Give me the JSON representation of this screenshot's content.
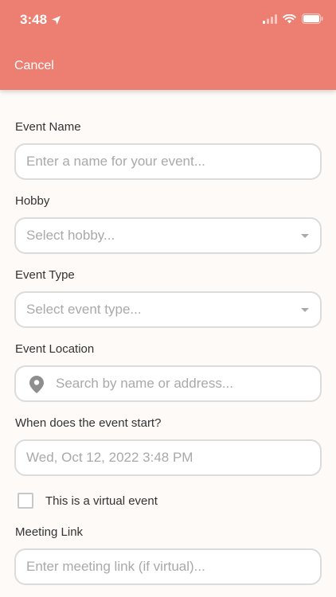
{
  "status_bar": {
    "time": "3:48"
  },
  "header": {
    "cancel_label": "Cancel"
  },
  "form": {
    "event_name": {
      "label": "Event Name",
      "placeholder": "Enter a name for your event..."
    },
    "hobby": {
      "label": "Hobby",
      "placeholder": "Select hobby..."
    },
    "event_type": {
      "label": "Event Type",
      "placeholder": "Select event type..."
    },
    "event_location": {
      "label": "Event Location",
      "placeholder": "Search by name or address..."
    },
    "start": {
      "label": "When does the event start?",
      "value": "Wed, Oct 12, 2022 3:48 PM"
    },
    "virtual": {
      "label": "This is a virtual event",
      "checked": false
    },
    "meeting_link": {
      "label": "Meeting Link",
      "placeholder": "Enter meeting link (if virtual)..."
    }
  },
  "colors": {
    "header": "#ec7e72",
    "background": "#fdfaf8",
    "border": "#dcdcdc",
    "placeholder": "#a9a9a9"
  }
}
